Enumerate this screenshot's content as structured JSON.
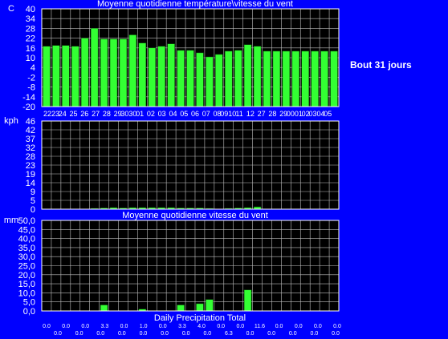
{
  "side_label": "Bout 31 jours",
  "colors": {
    "background": "#0000ff",
    "plot_background": "#000000",
    "bar": "#33ff33",
    "text": "#ffffff",
    "grid": "#c0c0c0"
  },
  "chart_data": [
    {
      "type": "bar",
      "title": "Moyenne quotidienne température\\vitesse du vent",
      "ylabel": "C",
      "ylim": [
        -20,
        40
      ],
      "yticks": [
        "40",
        "34",
        "28",
        "22",
        "16",
        "10",
        "4",
        "-2",
        "-8",
        "-14",
        "-20"
      ],
      "grid": true,
      "categories": [
        "22",
        "23",
        "24",
        "25",
        "26",
        "27",
        "28",
        "29",
        "30",
        "30",
        "01",
        "02",
        "03",
        "04",
        "05",
        "06",
        "07",
        "08",
        "09",
        "10",
        "11",
        "12",
        "27",
        "28",
        "29",
        "00",
        "01",
        "02",
        "03",
        "04",
        "05"
      ],
      "category_labels": [
        "2223",
        "24",
        "25",
        "26",
        "27",
        "28",
        "29",
        "3030",
        "01",
        "02",
        "03",
        "04",
        "05",
        "06",
        "07",
        "08",
        "0910",
        "11",
        "12",
        "27",
        "28",
        "29",
        "0001",
        "02",
        "0304",
        "05"
      ],
      "values": [
        17,
        17.5,
        17.5,
        17,
        22,
        28,
        21.5,
        21.5,
        21.5,
        24,
        19,
        16,
        17,
        18.5,
        14.5,
        14.5,
        13,
        10.5,
        12,
        14,
        14.5,
        18,
        17,
        14,
        14,
        14,
        14,
        14,
        14,
        14,
        14
      ]
    },
    {
      "type": "bar",
      "title": "",
      "ylabel": "kph",
      "ylim": [
        0,
        46
      ],
      "yticks": [
        "46",
        "42",
        "37",
        "32",
        "28",
        "23",
        "19",
        "14",
        "9",
        "5",
        "0"
      ],
      "grid": true,
      "values": [
        0,
        0,
        0,
        0,
        0,
        0.4,
        0.6,
        0.8,
        0.6,
        0.8,
        0.8,
        0.8,
        0.8,
        0.8,
        0.6,
        0.6,
        0.6,
        0.4,
        0,
        0.4,
        0.6,
        0.8,
        1.2,
        0,
        0,
        0,
        0,
        0,
        0,
        0,
        0
      ]
    },
    {
      "type": "bar",
      "title": "Moyenne quotidienne vitesse du vent",
      "xlabel": "Daily Precipitation Total",
      "ylabel": "mm",
      "ylim": [
        0,
        50
      ],
      "yticks": [
        "50,0",
        "45,0",
        "40,0",
        "35,0",
        "30,0",
        "25,0",
        "20,0",
        "15,0",
        "10,0",
        "5,0",
        "0,0"
      ],
      "grid": true,
      "values": [
        0,
        0,
        0,
        0,
        0,
        0,
        3.3,
        0,
        0,
        0,
        1.0,
        0,
        0,
        0,
        3.3,
        0,
        4.0,
        6.3,
        0,
        0,
        0,
        11.6,
        0,
        0,
        0,
        0,
        0,
        0,
        0,
        0,
        0
      ],
      "precip_labels_top": [
        "0.0",
        "0.0",
        "0.0",
        "3.3",
        "0.0",
        "1.0",
        "0.0",
        "3.3",
        "4.0",
        "0.0",
        "0.0",
        "11.6",
        "0.0",
        "0.0",
        "0.0",
        "0.0"
      ],
      "precip_labels_bottom": [
        "0.0",
        "0.0",
        "0.0",
        "0.0",
        "0.0",
        "0.0",
        "0.0",
        "0.0",
        "6.3",
        "0.0",
        "0.0",
        "0.0",
        "0.0",
        "0.0"
      ]
    }
  ]
}
